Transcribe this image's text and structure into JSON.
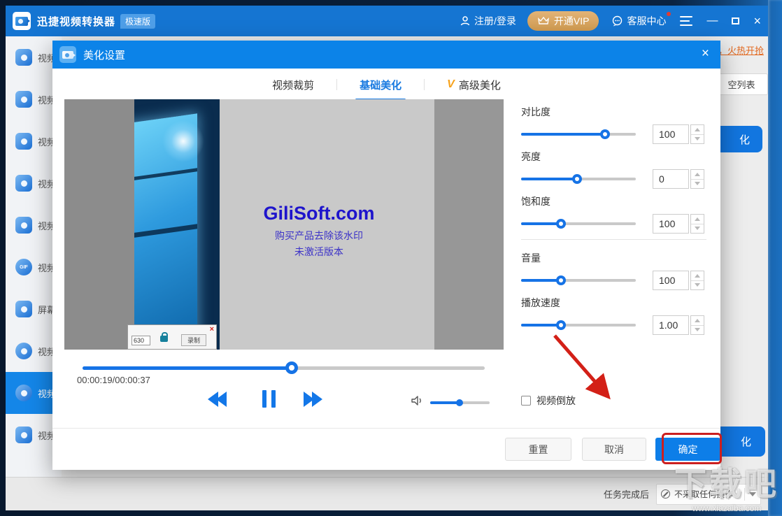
{
  "titlebar": {
    "title": "迅捷视频转换器",
    "badge": "极速版",
    "login": "注册/登录",
    "vip": "开通VIP",
    "support": "客服中心",
    "minimize_glyph": "—",
    "close_glyph": "×"
  },
  "sidebar": {
    "active_index": 8,
    "items": [
      {
        "label": "视频",
        "icon": "video-convert-icon",
        "icon_text": ""
      },
      {
        "label": "视频",
        "icon": "video-compress-icon",
        "icon_text": ""
      },
      {
        "label": "视频",
        "icon": "video-edit-icon",
        "icon_text": ""
      },
      {
        "label": "视频",
        "icon": "video-split-icon",
        "icon_text": ""
      },
      {
        "label": "视频",
        "icon": "video-merge-icon",
        "icon_text": ""
      },
      {
        "label": "视频",
        "icon": "video-gif-icon",
        "icon_text": "GIF"
      },
      {
        "label": "屏幕",
        "icon": "screen-record-icon",
        "icon_text": ""
      },
      {
        "label": "视频",
        "icon": "video-download-icon",
        "icon_text": ""
      },
      {
        "label": "视频",
        "icon": "video-beautify-icon",
        "icon_text": ""
      },
      {
        "label": "视频",
        "icon": "video-watermark-icon",
        "icon_text": ""
      }
    ]
  },
  "background": {
    "promo_link": "，火热开抢",
    "clear_list_visible": "空列表",
    "blue_button_top_visible": "化",
    "blue_button_bottom_visible": "化"
  },
  "bottom_bar": {
    "label": "任务完成后",
    "option": "不采取任何操作"
  },
  "dialog": {
    "title": "美化设置",
    "close_glyph": "×",
    "tabs": [
      {
        "label": "视频裁剪",
        "active": false
      },
      {
        "label": "基础美化",
        "active": true
      },
      {
        "label": "高级美化",
        "active": false,
        "vip_mark": "V"
      }
    ],
    "preview": {
      "watermark_title": "GiliSoft.com",
      "watermark_line1": "购买产品去除该水印",
      "watermark_line2": "未激活版本",
      "mini_window": {
        "close_glyph": "×",
        "field_value": "630",
        "record_button": "录制"
      }
    },
    "player": {
      "time": "00:00:19/00:00:37",
      "progress_percent": 52,
      "volume_percent": 49
    },
    "settings": {
      "rows": [
        {
          "label": "对比度",
          "value": "100",
          "percent": 73
        },
        {
          "label": "亮度",
          "value": "0",
          "percent": 49
        },
        {
          "label": "饱和度",
          "value": "100",
          "percent": 35
        },
        {
          "label": "音量",
          "value": "100",
          "percent": 35
        },
        {
          "label": "播放速度",
          "value": "1.00",
          "percent": 35
        }
      ],
      "reverse_label": "视频倒放",
      "reverse_checked": false
    },
    "buttons": {
      "reset": "重置",
      "cancel": "取消",
      "ok": "确定"
    }
  },
  "watermark": {
    "line1": "下载吧",
    "line2": "www.xiazaiba.com"
  },
  "colors": {
    "titlebar": "#1575d2",
    "dialog_header": "#0c83e8",
    "accent_blue": "#1673e6",
    "vip_gold": "#d8a659",
    "annotation_red": "#cc1f1f",
    "promo_orange": "#e2671d"
  }
}
